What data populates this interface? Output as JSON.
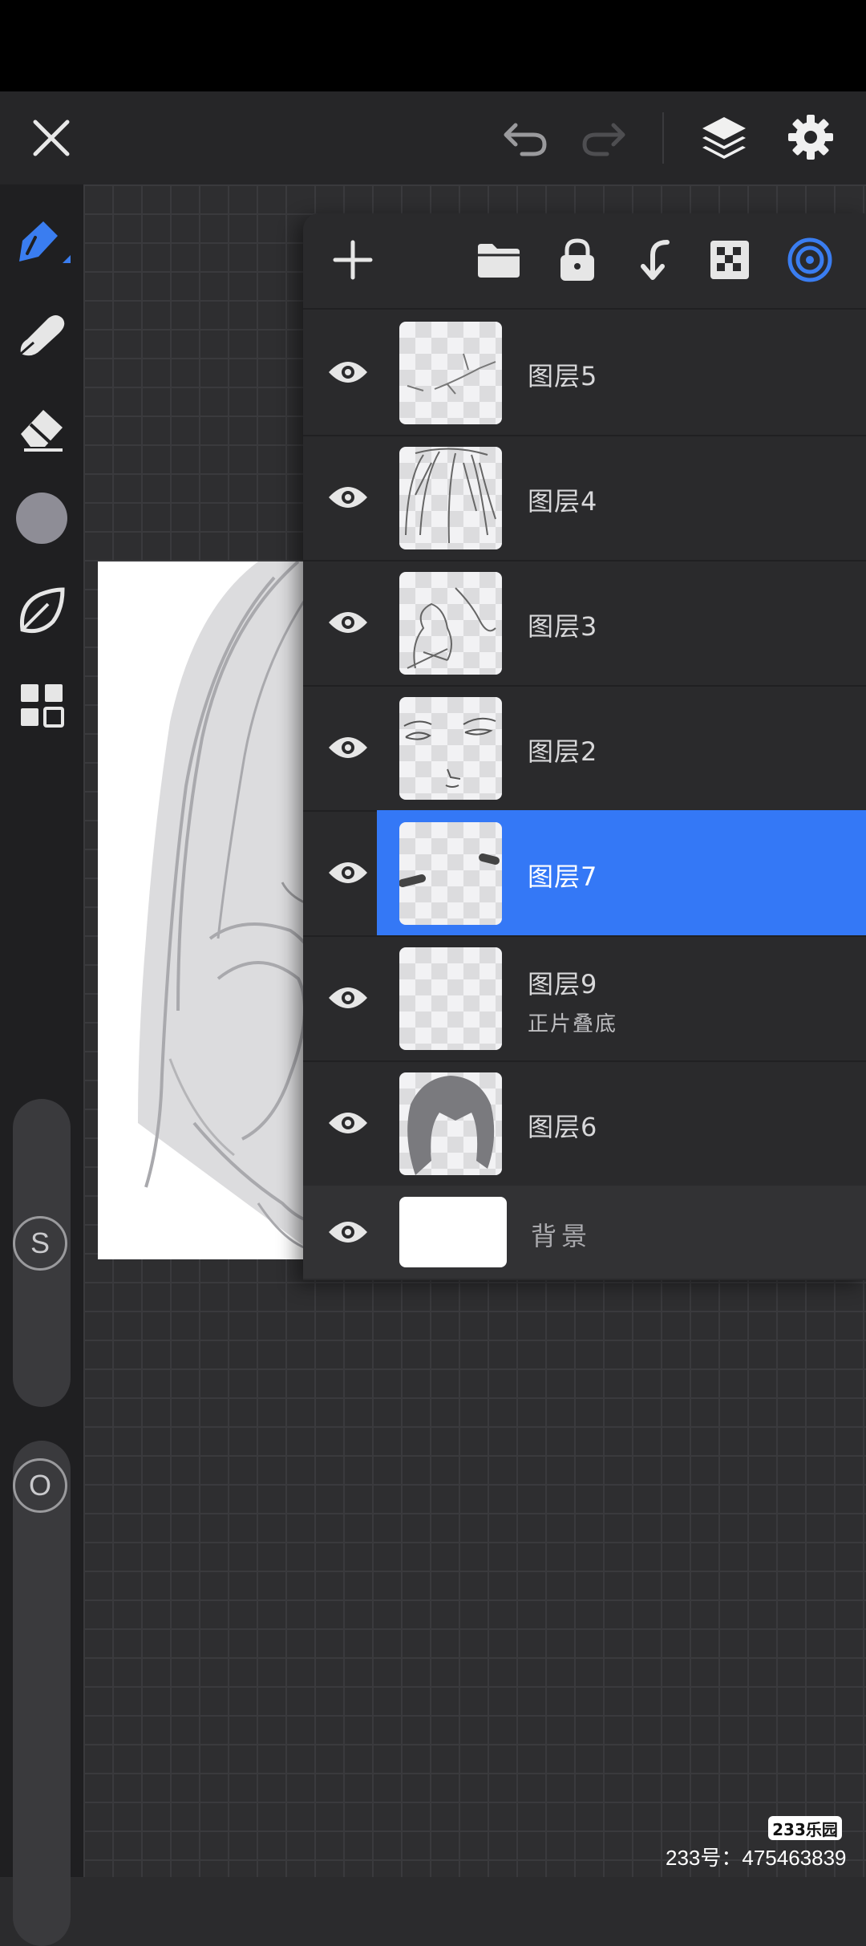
{
  "toolbar": {
    "icons": [
      "close-icon",
      "undo-icon",
      "redo-icon",
      "layers-icon",
      "settings-icon"
    ]
  },
  "left_tools": {
    "icons": [
      "brush-icon",
      "smudge-icon",
      "eraser-icon",
      "color-swatch",
      "leaf-icon",
      "grid-icon"
    ],
    "color_swatch": "#8e8d96",
    "size_slider_label": "S",
    "opacity_slider_label": "O"
  },
  "layers_panel": {
    "header_icons": [
      "add-icon",
      "folder-icon",
      "lock-icon",
      "merge-down-icon",
      "transparency-icon",
      "target-icon"
    ],
    "accent": "#3478f6",
    "layers": [
      {
        "name": "图层5",
        "mode": "",
        "selected": false
      },
      {
        "name": "图层4",
        "mode": "",
        "selected": false
      },
      {
        "name": "图层3",
        "mode": "",
        "selected": false
      },
      {
        "name": "图层2",
        "mode": "",
        "selected": false
      },
      {
        "name": "图层7",
        "mode": "",
        "selected": true
      },
      {
        "name": "图层9",
        "mode": "正片叠底",
        "selected": false
      },
      {
        "name": "图层6",
        "mode": "",
        "selected": false
      }
    ],
    "background": {
      "name": "背景"
    }
  },
  "watermark": {
    "logo": "233乐园",
    "text": "233号：475463839"
  }
}
